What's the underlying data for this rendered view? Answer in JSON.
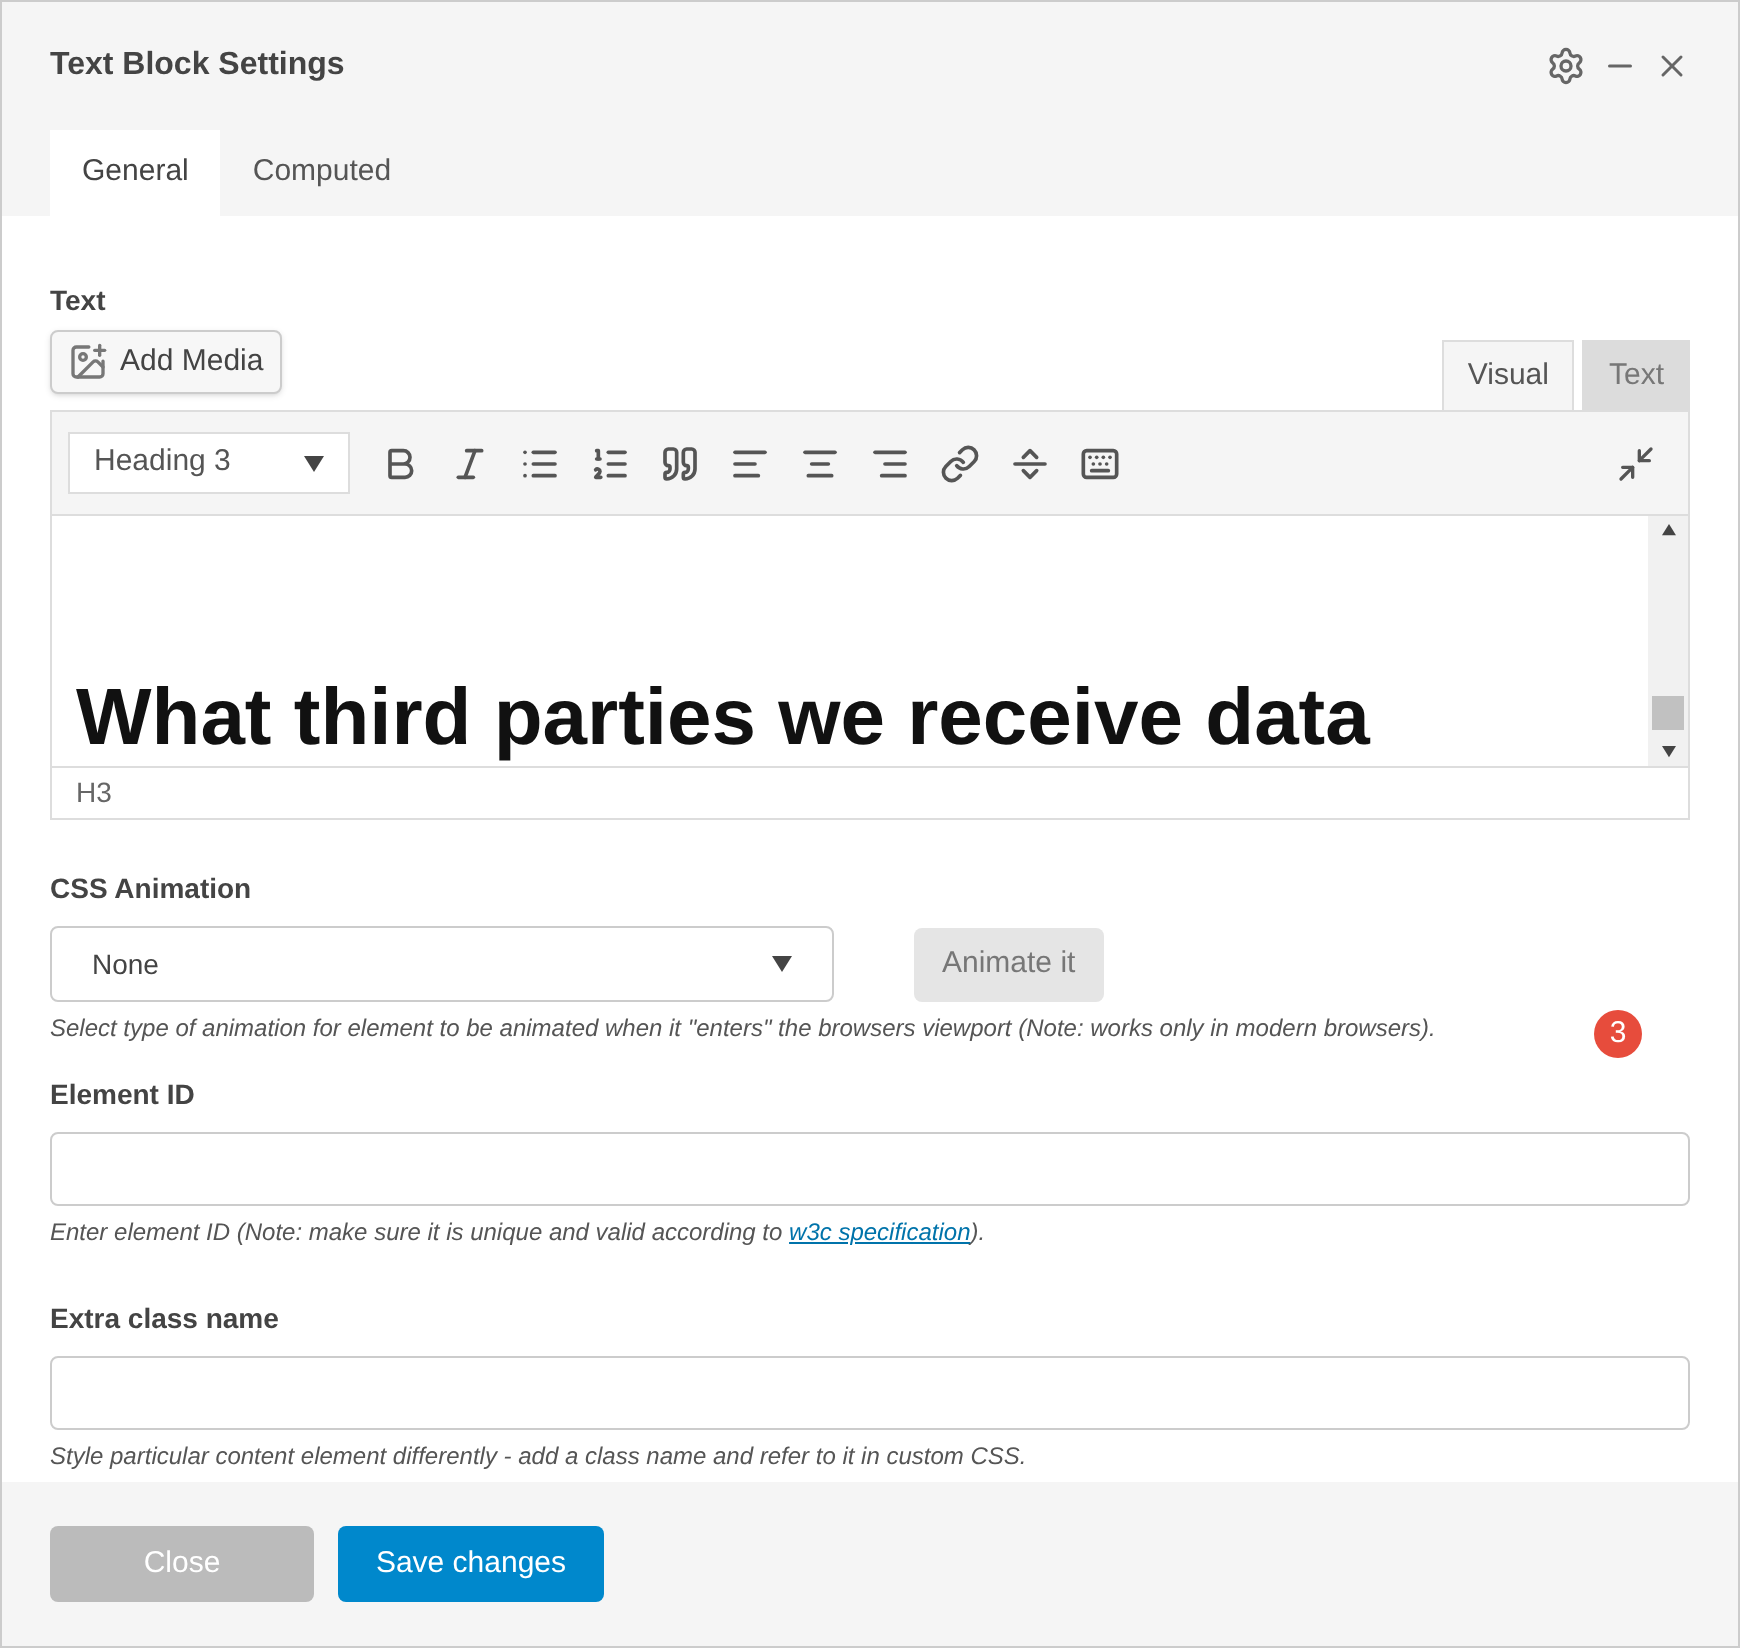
{
  "window": {
    "title": "Text Block Settings"
  },
  "tabs": [
    {
      "label": "General",
      "selected": true
    },
    {
      "label": "Computed",
      "selected": false
    }
  ],
  "text_field": {
    "label": "Text",
    "add_media": "Add Media",
    "editor_tabs": [
      {
        "label": "Visual",
        "selected": true
      },
      {
        "label": "Text",
        "selected": false
      }
    ],
    "format": "Heading 3",
    "content": "What third parties we receive data",
    "path": "H3"
  },
  "css_animation": {
    "label": "CSS Animation",
    "value": "None",
    "button": "Animate it",
    "help": "Select type of animation for element to be animated when it \"enters\" the browsers viewport (Note: works only in modern browsers).",
    "badge": "3"
  },
  "element_id": {
    "label": "Element ID",
    "help_before": "Enter element ID (Note: make sure it is unique and valid according to ",
    "link": "w3c specification",
    "help_after": ")."
  },
  "extra_class": {
    "label": "Extra class name",
    "help": "Style particular content element differently - add a class name and refer to it in custom CSS."
  },
  "buttons": [
    {
      "label": "Close",
      "kind": "secondary"
    },
    {
      "label": "Save changes",
      "kind": "primary"
    }
  ]
}
